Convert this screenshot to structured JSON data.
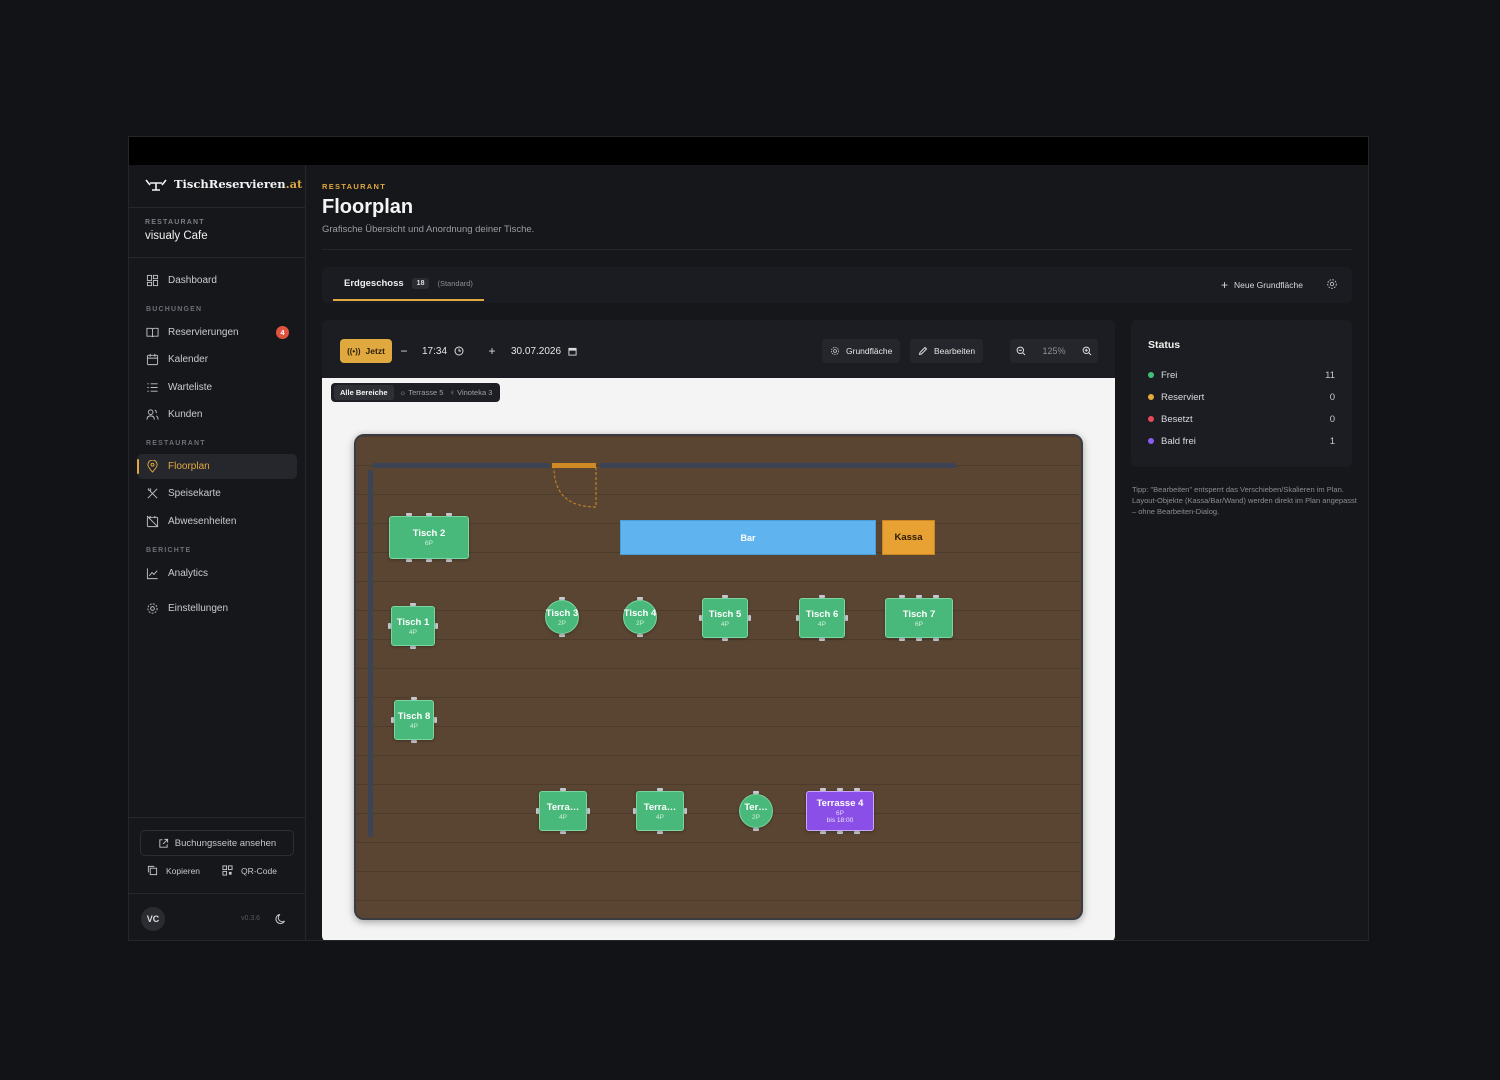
{
  "app": {
    "brand": "TischReservieren",
    "brand_tld": ".at"
  },
  "restaurant": {
    "label": "RESTAURANT",
    "name": "visualy Cafe"
  },
  "sidebar": {
    "dashboard": "Dashboard",
    "section_bookings": "BUCHUNGEN",
    "reservations": "Reservierungen",
    "reservations_badge": "4",
    "calendar": "Kalender",
    "waitlist": "Warteliste",
    "customers": "Kunden",
    "section_restaurant": "RESTAURANT",
    "floorplan": "Floorplan",
    "menu": "Speisekarte",
    "absences": "Abwesenheiten",
    "section_reports": "BERICHTE",
    "analytics": "Analytics",
    "settings": "Einstellungen",
    "booking_page": "Buchungsseite ansehen",
    "copy": "Kopieren",
    "qr": "QR-Code",
    "avatar": "VC",
    "version": "v0.3.6"
  },
  "header": {
    "eyebrow": "RESTAURANT",
    "title": "Floorplan",
    "subtitle": "Grafische Übersicht und Anordnung deiner Tische."
  },
  "floors": {
    "tab_label": "Erdgeschoss",
    "tab_count": "18",
    "tab_tag": "(Standard)",
    "new_floor": "Neue Grundfläche"
  },
  "toolbar": {
    "now": "Jetzt",
    "time": "17:34",
    "date": "30.07.2026",
    "floor_btn": "Grundfläche",
    "edit_btn": "Bearbeiten",
    "zoom": "125%"
  },
  "areas": {
    "all": "Alle Bereiche",
    "terrace": "Terrasse 5",
    "vinoteka": "Vinoteka 3"
  },
  "layout_objects": {
    "bar": "Bar",
    "kassa": "Kassa"
  },
  "tables": [
    {
      "name": "Tisch 2",
      "cap": "6P",
      "shape": "rect",
      "status": "free"
    },
    {
      "name": "Tisch 1",
      "cap": "4P",
      "shape": "rect",
      "status": "free"
    },
    {
      "name": "Tisch 3",
      "cap": "2P",
      "shape": "round",
      "status": "free"
    },
    {
      "name": "Tisch 4",
      "cap": "2P",
      "shape": "round",
      "status": "free"
    },
    {
      "name": "Tisch 5",
      "cap": "4P",
      "shape": "rect",
      "status": "free"
    },
    {
      "name": "Tisch 6",
      "cap": "4P",
      "shape": "rect",
      "status": "free"
    },
    {
      "name": "Tisch 7",
      "cap": "6P",
      "shape": "rect",
      "status": "free"
    },
    {
      "name": "Tisch 8",
      "cap": "4P",
      "shape": "rect",
      "status": "free"
    },
    {
      "name": "Terra…",
      "cap": "4P",
      "shape": "rect",
      "status": "free"
    },
    {
      "name": "Terra…",
      "cap": "4P",
      "shape": "rect",
      "status": "free"
    },
    {
      "name": "Ter…",
      "cap": "2P",
      "shape": "round",
      "status": "free"
    },
    {
      "name": "Terrasse 4",
      "cap": "6P",
      "extra": "bis 18:00",
      "shape": "rect",
      "status": "soon"
    }
  ],
  "status": {
    "title": "Status",
    "rows": [
      {
        "label": "Frei",
        "value": "11",
        "color": "#3fbf7a"
      },
      {
        "label": "Reserviert",
        "value": "0",
        "color": "#e7a93a"
      },
      {
        "label": "Besetzt",
        "value": "0",
        "color": "#e9475a"
      },
      {
        "label": "Bald frei",
        "value": "1",
        "color": "#8a5cf0"
      }
    ]
  },
  "tip": "Tipp: \"Bearbeiten\" entsperrt das Verschieben/Skalieren im Plan. Layout-Objekte (Kassa/Bar/Wand) werden direkt im Plan angepasst – ohne Bearbeiten-Dialog.",
  "colors": {
    "accent": "#e0a93f",
    "free": "#48b97a",
    "soon": "#8a4fe6",
    "bar": "#5fb4ef",
    "kassa": "#e8a133"
  }
}
